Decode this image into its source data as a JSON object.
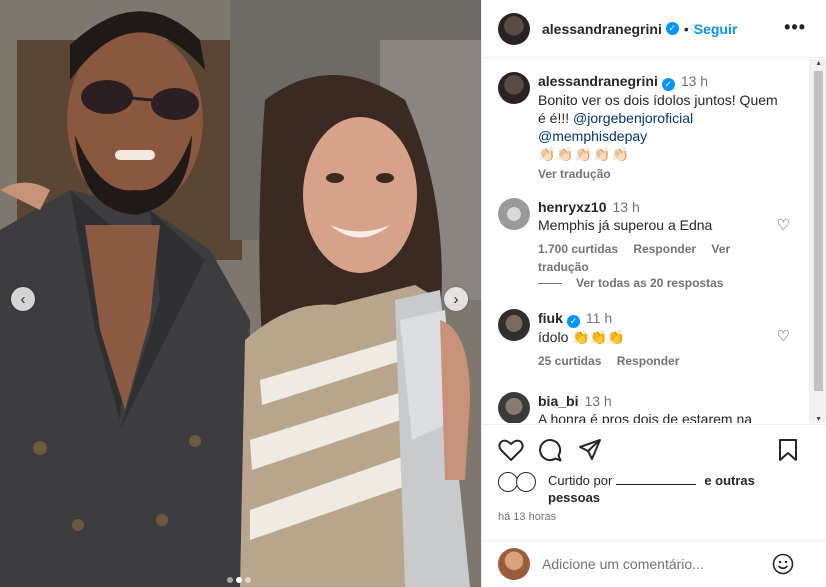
{
  "post": {
    "author": "alessandranegrini",
    "follow_label": "Seguir",
    "separator": "•",
    "more_label": "•••"
  },
  "caption": {
    "author": "alessandranegrini",
    "time": "13 h",
    "text": "Bonito ver os dois ídolos juntos! Quem é é!!!",
    "mention1": "@jorgebenjoroficial",
    "mention2": "@memphisdepay",
    "emojis": "👏🏻👏🏻👏🏻👏🏻👏🏻",
    "translate": "Ver tradução"
  },
  "comments": [
    {
      "user": "henryxz10",
      "time": "13 h",
      "text": "Memphis já superou a Edna",
      "likes": "1.700 curtidas",
      "reply": "Responder",
      "translate": "Ver tradução"
    },
    {
      "user": "fiuk",
      "time": "11 h",
      "text": "ídolo 👏👏👏",
      "likes": "25 curtidas",
      "reply": "Responder"
    },
    {
      "user": "bia_bi",
      "time": "13 h",
      "text": "A honra é pros dois de estarem na"
    }
  ],
  "view_replies": "Ver todas as 20 respostas",
  "likes": {
    "prefix": "Curtido por",
    "suffix": "e outras pessoas"
  },
  "posted_ago": "há 13 horas",
  "add_comment": {
    "placeholder": "Adicione um comentário..."
  },
  "colors": {
    "accent": "#0095f6",
    "verified": "#0095f6",
    "muted": "#737373"
  },
  "icons": [
    "verified-badge-icon",
    "more-options-icon",
    "heart-icon",
    "comment-icon",
    "share-icon",
    "bookmark-icon",
    "emoji-icon",
    "chevron-left-icon",
    "chevron-right-icon"
  ]
}
